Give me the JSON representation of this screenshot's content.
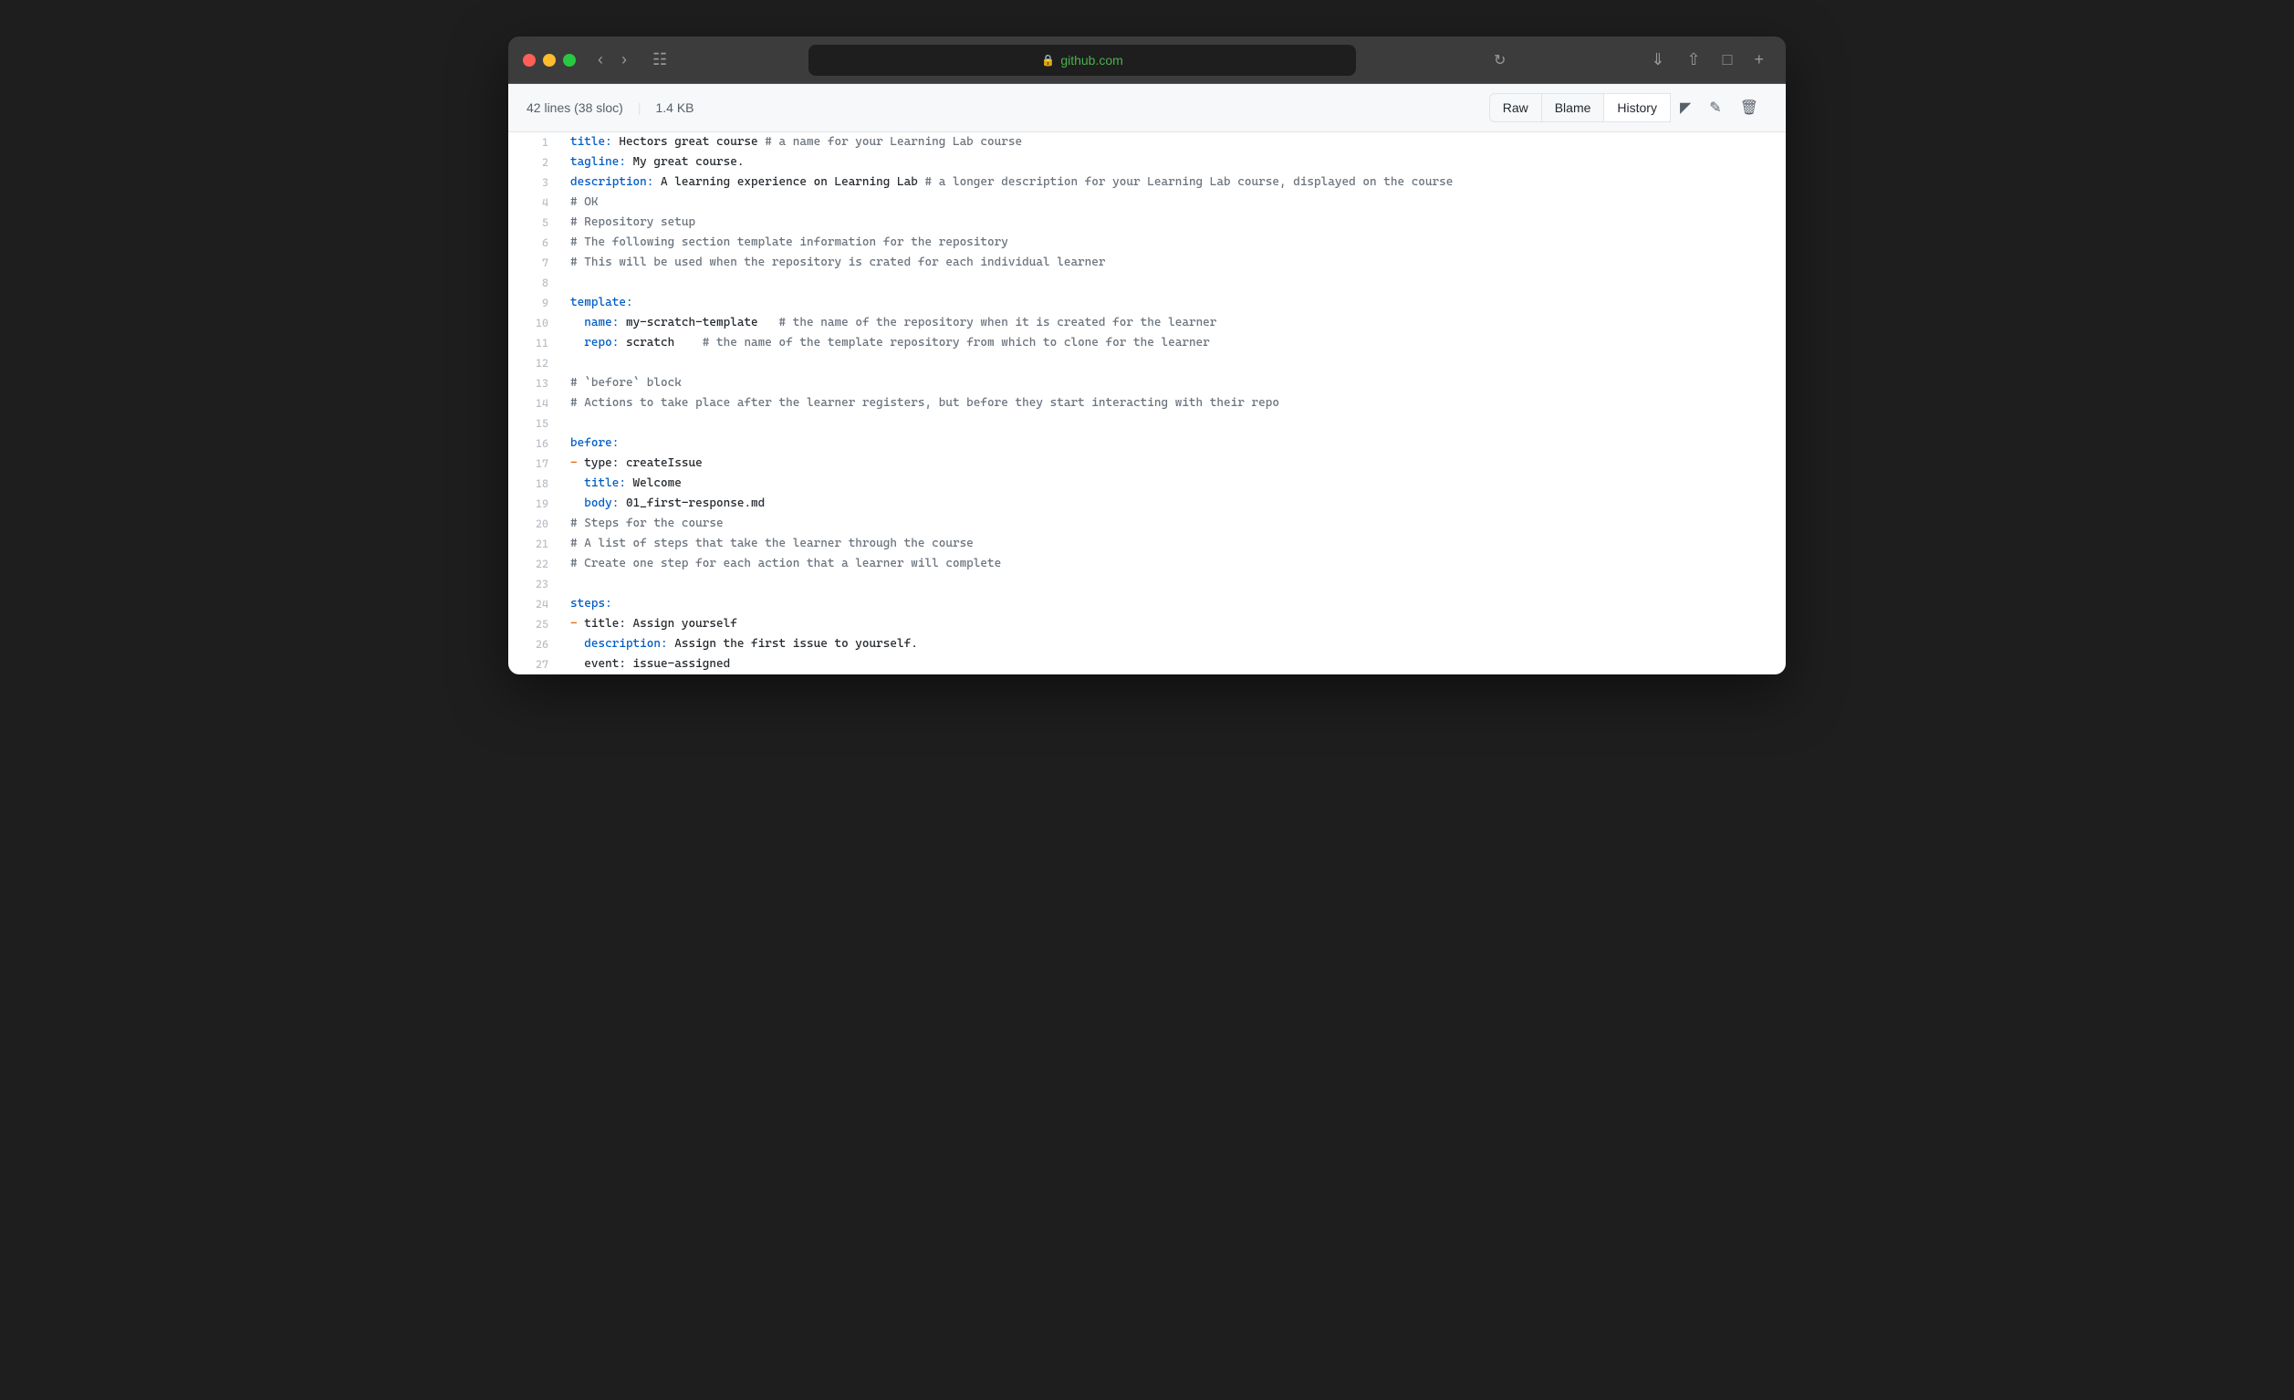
{
  "browser": {
    "url": "github.com",
    "url_display": " github.com"
  },
  "toolbar": {
    "raw_label": "Raw",
    "blame_label": "Blame",
    "history_label": "History"
  },
  "file_info": {
    "lines": "42 lines (38 sloc)",
    "size": "1.4 KB"
  },
  "code_lines": [
    {
      "num": 1,
      "content": "title: Hectors great course # a name for your Learning Lab course"
    },
    {
      "num": 2,
      "content": "tagline: My great course."
    },
    {
      "num": 3,
      "content": "description: A learning experience on Learning Lab # a longer description for your Learning Lab course, displayed on the course"
    },
    {
      "num": 4,
      "content": "# OK"
    },
    {
      "num": 5,
      "content": "# Repository setup"
    },
    {
      "num": 6,
      "content": "# The following section template information for the repository"
    },
    {
      "num": 7,
      "content": "# This will be used when the repository is crated for each individual learner"
    },
    {
      "num": 8,
      "content": ""
    },
    {
      "num": 9,
      "content": "template:"
    },
    {
      "num": 10,
      "content": "  name: my-scratch-template   # the name of the repository when it is created for the learner"
    },
    {
      "num": 11,
      "content": "  repo: scratch    # the name of the template repository from which to clone for the learner"
    },
    {
      "num": 12,
      "content": ""
    },
    {
      "num": 13,
      "content": "# `before` block"
    },
    {
      "num": 14,
      "content": "# Actions to take place after the learner registers, but before they start interacting with their repo"
    },
    {
      "num": 15,
      "content": ""
    },
    {
      "num": 16,
      "content": "before:"
    },
    {
      "num": 17,
      "content": "- type: createIssue"
    },
    {
      "num": 18,
      "content": "  title: Welcome"
    },
    {
      "num": 19,
      "content": "  body: 01_first-response.md"
    },
    {
      "num": 20,
      "content": "# Steps for the course"
    },
    {
      "num": 21,
      "content": "# A list of steps that take the learner through the course"
    },
    {
      "num": 22,
      "content": "# Create one step for each action that a learner will complete"
    },
    {
      "num": 23,
      "content": ""
    },
    {
      "num": 24,
      "content": "steps:"
    },
    {
      "num": 25,
      "content": "- title: Assign yourself"
    },
    {
      "num": 26,
      "content": "  description: Assign the first issue to yourself."
    },
    {
      "num": 27,
      "content": "  event: issue-assigned"
    }
  ]
}
